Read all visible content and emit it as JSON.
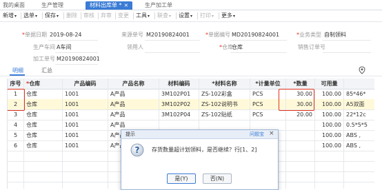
{
  "tabs": [
    {
      "label": "我的桌面"
    },
    {
      "label": "生产管理"
    },
    {
      "label": "材料出库单 *",
      "close": "×"
    },
    {
      "label": "生产加工单"
    }
  ],
  "toolbar": {
    "new": "新增",
    "select": "选单",
    "save": "保存",
    "delete": "删除",
    "audit": "审核",
    "unaudit": "弃审",
    "change": "变更",
    "tools": "工具",
    "link": "联查",
    "settings": "设置",
    "print": "打印",
    "more": "更多"
  },
  "form": {
    "doc_date_label": "单据日期",
    "doc_date": "2019-08-24",
    "source_label": "来源单号",
    "source": "M20190824001",
    "doc_no_label": "单据编号",
    "doc_no": "MD20190824001",
    "biz_type_label": "业务类型",
    "biz_type": "自制领料",
    "workshop_label": "生产车间",
    "workshop": "A车间",
    "picker_label": "领用人",
    "picker": "",
    "warehouse_label": "仓库",
    "warehouse": "仓库",
    "sales_label": "销售订单号",
    "sales": "",
    "process_label": "加工单号",
    "process": "M20190824001"
  },
  "detail_tabs": {
    "detail": "明细",
    "summary": "汇总"
  },
  "grid": {
    "headers": [
      "序号",
      "*仓库",
      "产品编码",
      "产品名称",
      "材料编码",
      "*材料名称",
      "*计量单位",
      "*数量",
      "可用量"
    ],
    "rows": [
      {
        "seq": "1",
        "wh": "仓库",
        "pcode": "1001",
        "pname": "A产品",
        "mcode": "3M102P01",
        "mname": "ZS-102彩盒",
        "unit": "PCS",
        "qty": "30.00",
        "avail": "100.00",
        "spec": "85*46*"
      },
      {
        "seq": "2",
        "wh": "仓库",
        "pcode": "1001",
        "pname": "A产品",
        "mcode": "3M102P02",
        "mname": "ZS-102说明书",
        "unit": "PCS",
        "qty": "30.00",
        "avail": "100.00",
        "spec": "A5双面"
      },
      {
        "seq": "3",
        "wh": "仓库",
        "pcode": "1001",
        "pname": "A产品",
        "mcode": "3M102P04",
        "mname": "ZS-102贴纸",
        "unit": "PCS",
        "qty": "20.00",
        "avail": "100.00",
        "spec": "22*12c"
      },
      {
        "seq": "4",
        "wh": "仓库",
        "pcode": "1001",
        "pname": "A产品",
        "mcode": "",
        "mname": "",
        "unit": "",
        "qty": "",
        "avail": "100.00",
        "spec": "0.5*5*5"
      },
      {
        "seq": "5",
        "wh": "仓库",
        "pcode": "1001",
        "pname": "A产品",
        "mcode": "",
        "mname": "",
        "unit": "",
        "qty": "",
        "avail": "100.00",
        "spec": "ABS ,"
      },
      {
        "seq": "6",
        "wh": "仓库",
        "pcode": "1001",
        "pname": "A产品",
        "mcode": "",
        "mname": "",
        "unit": "",
        "qty": "",
        "avail": "100.00",
        "spec": "ABS ,"
      }
    ]
  },
  "dialog": {
    "title": "提示",
    "assistant": "问题宝",
    "close": "×",
    "message": "存货数量超计划领料，是否继续？行[1、2]",
    "yes": "是(Y)",
    "no": "否(N)"
  },
  "colors": {
    "accent": "#3a7bd5",
    "highlight": "#e0301e",
    "selected_row": "#fff9d9"
  }
}
